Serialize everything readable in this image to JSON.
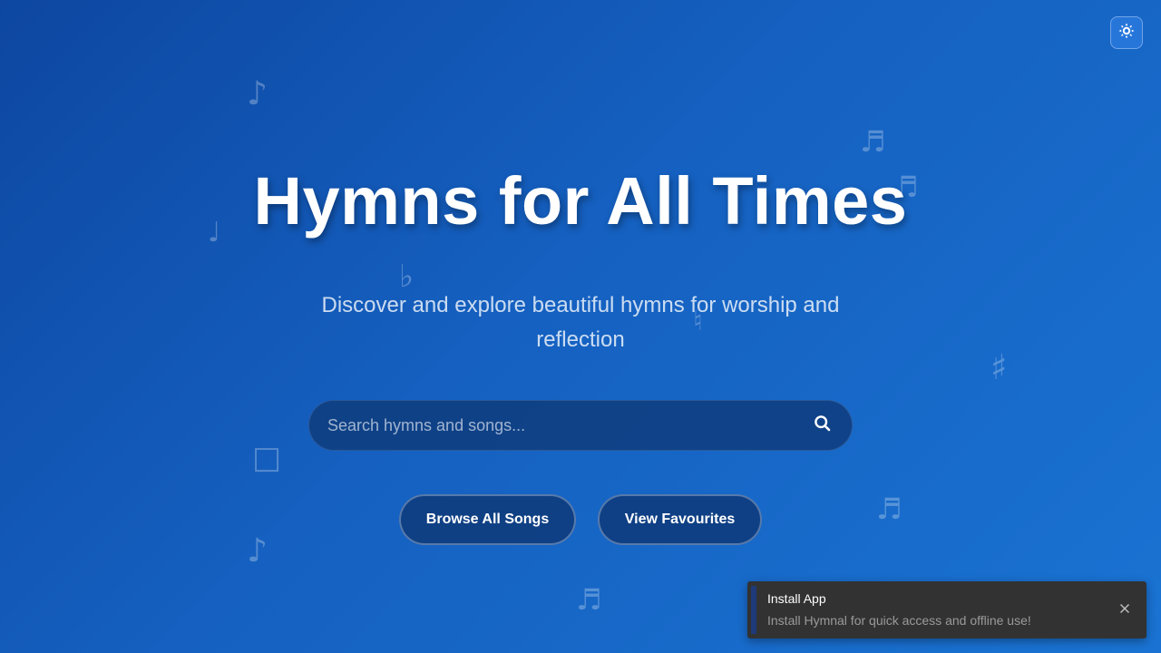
{
  "theme_toggle": {
    "icon": "brightness-icon"
  },
  "hero": {
    "title": "Hymns for All Times",
    "subtitle": "Discover and explore beautiful hymns for worship and reflection"
  },
  "search": {
    "placeholder": "Search hymns and songs...",
    "value": "",
    "icon": "search-icon"
  },
  "actions": {
    "browse_label": "Browse All Songs",
    "favourites_label": "View Favourites"
  },
  "toast": {
    "title": "Install App",
    "message": "Install Hymnal for quick access and offline use!",
    "close_icon": "close-icon"
  },
  "decorations": {
    "notes": [
      "♪",
      "♬",
      "♬",
      "♩",
      "♭",
      "♮",
      "♯",
      "□",
      "♬",
      "♪",
      "♬"
    ]
  },
  "colors": {
    "background_start": "#0d47a1",
    "background_end": "#1a73d2",
    "toast_background": "#323232"
  }
}
